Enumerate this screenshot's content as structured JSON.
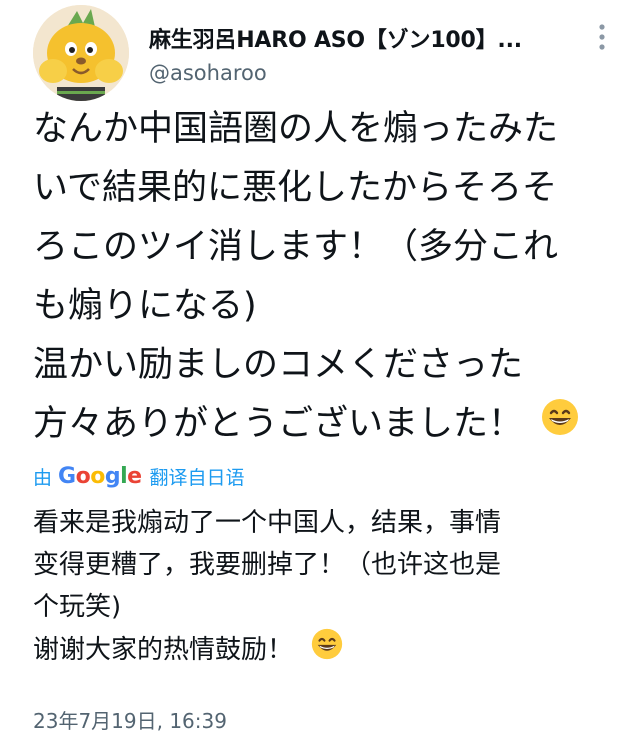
{
  "tweet": {
    "author": {
      "display_name": "麻生羽呂HARO ASO【ゾン100】...",
      "handle": "@asoharoo",
      "avatar_icon": "cartoon-mascot-avatar"
    },
    "more_icon": "more-vertical-icon",
    "body_lines": [
      "なんか中国語圏の人を煽ったみた",
      "いで結果的に悪化したからそろそ",
      "ろこのツイ消します！（多分これ",
      "も煽りになる)",
      "温かい励ましのコメくださった",
      "方々ありがとうございました！"
    ],
    "emoji": "grinning-face-emoji",
    "translation": {
      "prefix": "由",
      "google_letters": [
        "G",
        "o",
        "o",
        "g",
        "l",
        "e"
      ],
      "suffix": "翻译自日语",
      "colors": {
        "blue": "#4285f4",
        "red": "#ea4335",
        "yellow": "#fbbc05",
        "green": "#34a853",
        "link": "#1d9bf0"
      },
      "lines": [
        "看来是我煽动了一个中国人，结果，事情",
        "变得更糟了，我要删掉了！（也许这也是",
        "个玩笑)",
        "谢谢大家的热情鼓励！"
      ]
    },
    "timestamp": "23年7月19日, 16:39"
  }
}
